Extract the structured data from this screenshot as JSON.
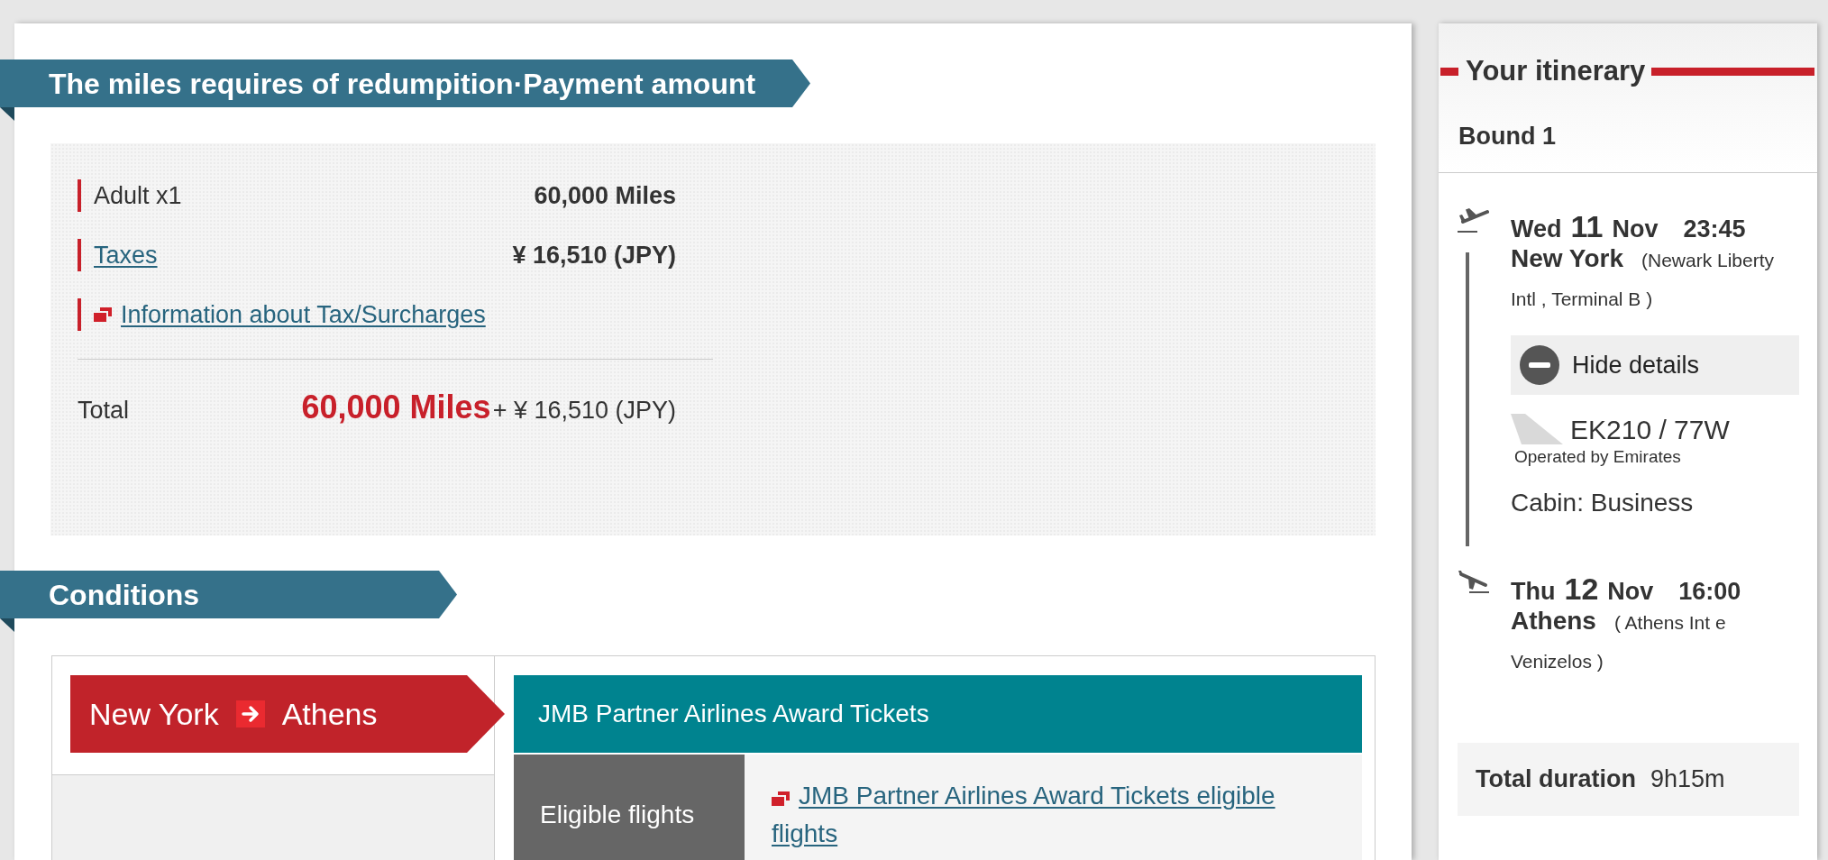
{
  "payment": {
    "title": "The miles requires of redumpition·Payment amount",
    "rows": [
      {
        "kind": "plain",
        "label": "Adult x1",
        "value": "60,000 Miles"
      },
      {
        "kind": "link",
        "label": "Taxes",
        "value": "¥ 16,510 (JPY)"
      },
      {
        "kind": "info_link",
        "label": "Information about Tax/Surcharges"
      }
    ],
    "total": {
      "label": "Total",
      "miles": "60,000 Miles",
      "amount": "+ ¥ 16,510 (JPY)"
    }
  },
  "conditions": {
    "title": "Conditions",
    "route": {
      "origin": "New York",
      "destination": "Athens"
    },
    "award_type": "JMB Partner Airlines Award Tickets",
    "rows": [
      {
        "label": "Eligible flights",
        "link": "JMB Partner Airlines Award Tickets eligible flights"
      }
    ]
  },
  "itinerary": {
    "title": "Your itinerary",
    "bound": "Bound 1",
    "segments": [
      {
        "kind": "departure",
        "weekday": "Wed",
        "day": "11",
        "month": "Nov",
        "time": "23:45",
        "city": "New York",
        "airport": "(Newark Liberty Intl , Terminal B )",
        "details": {
          "expanded": true,
          "toggle_label": "Hide details",
          "flight": "EK210 / 77W",
          "operated_by": "Operated by Emirates",
          "cabin": "Cabin: Business"
        }
      },
      {
        "kind": "arrival",
        "weekday": "Thu",
        "day": "12",
        "month": "Nov",
        "time": "16:00",
        "city": "Athens",
        "airport": "( Athens Int e Venizelos )"
      }
    ],
    "total_duration": {
      "label": "Total duration",
      "value": "9h15m"
    }
  }
}
